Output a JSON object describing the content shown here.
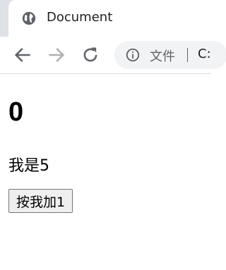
{
  "browser": {
    "tab": {
      "title": "Document",
      "favicon": "globe-icon"
    },
    "toolbar": {
      "back_icon": "arrow-left-icon",
      "forward_icon": "arrow-right-icon",
      "reload_icon": "reload-icon",
      "info_icon": "info-icon",
      "scheme_label": "文件",
      "url": "C:"
    }
  },
  "page": {
    "count": "0",
    "prop_text": "我是5",
    "add_button_label": "按我加1"
  },
  "colors": {
    "tabstrip": "#dee1e6",
    "omnibox": "#f1f3f4",
    "icon": "#5f6368",
    "icon_disabled": "#b0b0b0"
  }
}
